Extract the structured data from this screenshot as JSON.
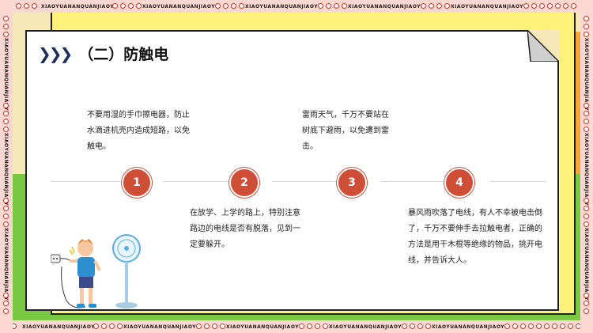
{
  "border_text": "XIAOYUANANQUANJIAOYU",
  "title": "（二）防触电",
  "chevrons": "❯❯❯",
  "steps": [
    {
      "number": "1",
      "text": "不要用湿的手巾擦电器，防止水滴进机壳内造成短路，以免触电。"
    },
    {
      "number": "2",
      "text": "在放学、上学的路上，特别注意路边的电线是否有脱落，见到一定要躲开。"
    },
    {
      "number": "3",
      "text": "雷雨天气，千万不要站在树底下避雨，以免遭到雷击。"
    },
    {
      "number": "4",
      "text": "暴风雨吹落了电线，有人不幸被电击倒了，千万不要伸手去拉触电者，正确的方法是用干木棍等绝缘的物品，挑开电线，并告诉大人。"
    }
  ],
  "colors": {
    "accent": "#cf4e37",
    "chevron": "#1f2d5a",
    "green": "#7ac943",
    "yellow": "#fff27a",
    "orange": "#f7a63a"
  }
}
